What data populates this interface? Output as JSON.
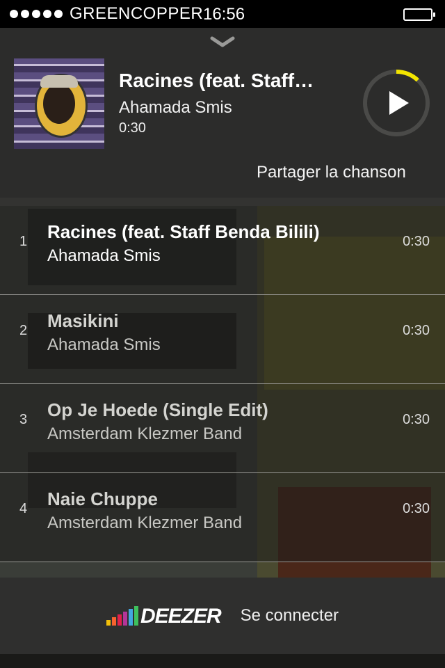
{
  "status_bar": {
    "carrier": "GREENCOPPER",
    "time": "16:56",
    "signal_dots": 5
  },
  "now_playing": {
    "collapse_icon": "chevron-down-icon",
    "title": "Racines (feat. Staff…",
    "artist": "Ahamada Smis",
    "time": "0:30",
    "progress": 0.12,
    "share_label": "Partager la chanson",
    "accent_color": "#f3e500"
  },
  "tracks": [
    {
      "number": "1",
      "title": "Racines (feat. Staff Benda Bilili)",
      "artist": "Ahamada Smis",
      "duration": "0:30"
    },
    {
      "number": "2",
      "title": "Masikini",
      "artist": "Ahamada Smis",
      "duration": "0:30"
    },
    {
      "number": "3",
      "title": "Op Je Hoede (Single Edit)",
      "artist": "Amsterdam Klezmer Band",
      "duration": "0:30"
    },
    {
      "number": "4",
      "title": "Naie Chuppe",
      "artist": "Amsterdam Klezmer Band",
      "duration": "0:30"
    }
  ],
  "footer": {
    "logo_text": "DEEZER",
    "connect_label": "Se connecter"
  }
}
